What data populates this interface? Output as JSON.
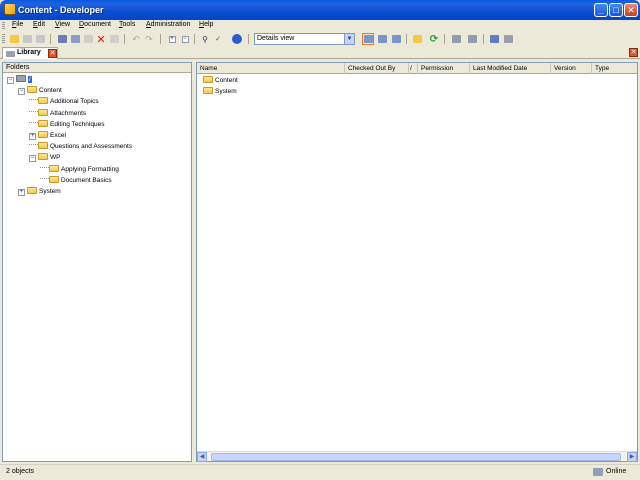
{
  "window": {
    "title": "Content - Developer"
  },
  "menu": [
    "File",
    "Edit",
    "View",
    "Document",
    "Tools",
    "Administration",
    "Help"
  ],
  "toolbar": {
    "view_select_value": "Details view",
    "buttons": [
      "open-folder",
      "save",
      "save-all",
      "cut",
      "copy",
      "paste",
      "delete",
      "rename",
      "undo",
      "redo",
      "expand",
      "collapse",
      "find",
      "spell-check",
      "help",
      "details-view",
      "list-view",
      "columns-view",
      "properties",
      "refresh",
      "check-out",
      "check-in",
      "import",
      "export"
    ]
  },
  "tabs": [
    {
      "label": "Library"
    }
  ],
  "folders_pane": {
    "header": "Folders",
    "tree": [
      {
        "label": "/",
        "depth": 0,
        "expanded": true,
        "root": true
      },
      {
        "label": "Content",
        "depth": 1,
        "expanded": true
      },
      {
        "label": "Additional Topics",
        "depth": 2
      },
      {
        "label": "Attachments",
        "depth": 2
      },
      {
        "label": "Editing Techniques",
        "depth": 2
      },
      {
        "label": "Excel",
        "depth": 2,
        "collapsed": true
      },
      {
        "label": "Questions and Assessments",
        "depth": 2
      },
      {
        "label": "WP",
        "depth": 2,
        "expanded": true
      },
      {
        "label": "Applying Formatting",
        "depth": 3
      },
      {
        "label": "Document Basics",
        "depth": 3
      },
      {
        "label": "System",
        "depth": 1,
        "collapsed": true
      }
    ]
  },
  "list_pane": {
    "columns": [
      "Name",
      "Checked Out By",
      "/",
      "Permission",
      "Last Modified Date",
      "Version",
      "Type"
    ],
    "rows": [
      {
        "name": "Content"
      },
      {
        "name": "System"
      }
    ]
  },
  "status": {
    "objects": "2 objects",
    "connection": "Online"
  }
}
